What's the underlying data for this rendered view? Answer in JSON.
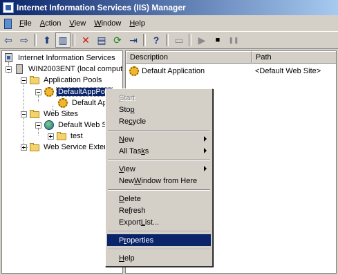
{
  "title": "Internet Information Services (IIS) Manager",
  "menu": [
    {
      "pre": "",
      "u": "F",
      "post": "ile"
    },
    {
      "pre": "",
      "u": "A",
      "post": "ction"
    },
    {
      "pre": "",
      "u": "V",
      "post": "iew"
    },
    {
      "pre": "",
      "u": "W",
      "post": "indow"
    },
    {
      "pre": "",
      "u": "H",
      "post": "elp"
    }
  ],
  "toolbar": {
    "icons": [
      "back-arrow-icon",
      "forward-arrow-icon",
      "up-folder-icon",
      "show-hide-tree-icon",
      "delete-icon",
      "properties-icon",
      "refresh-icon",
      "export-list-icon",
      "help-icon",
      "computer-icon",
      "play-icon",
      "stop-icon",
      "pause-icon"
    ],
    "glyphs": [
      "⇦",
      "⇨",
      "⬆",
      "▥",
      "✕",
      "▤",
      "⟳",
      "⇥",
      "?",
      "▭",
      "▶",
      "■",
      "❚❚"
    ]
  },
  "tree": {
    "root": "Internet Information Services",
    "server": "WIN2003ENT (local comput",
    "app_pools": "Application Pools",
    "default_pool": "DefaultAppPool",
    "default_app": "Default Ap",
    "web_sites": "Web Sites",
    "default_site": "Default Web S",
    "test": "test",
    "web_service_ext": "Web Service Exter"
  },
  "list": {
    "columns": [
      "Description",
      "Path"
    ],
    "rows": [
      {
        "description": "Default Application",
        "path": "<Default Web Site>"
      }
    ]
  },
  "context_menu": {
    "start": {
      "pre": "",
      "u": "S",
      "post": "tart"
    },
    "stop": {
      "pre": "Sto",
      "u": "p",
      "post": ""
    },
    "recycle": {
      "pre": "Re",
      "u": "c",
      "post": "ycle"
    },
    "new": {
      "pre": "",
      "u": "N",
      "post": "ew"
    },
    "all_tasks": {
      "pre": "All Tas",
      "u": "k",
      "post": "s"
    },
    "view": {
      "pre": "",
      "u": "V",
      "post": "iew"
    },
    "new_window": {
      "pre": "New ",
      "u": "W",
      "post": "indow from Here"
    },
    "delete": {
      "pre": "",
      "u": "D",
      "post": "elete"
    },
    "refresh": {
      "pre": "Re",
      "u": "f",
      "post": "resh"
    },
    "export_list": {
      "pre": "Export ",
      "u": "L",
      "post": "ist..."
    },
    "properties": {
      "pre": "P",
      "u": "r",
      "post": "operties"
    },
    "help": {
      "pre": "",
      "u": "H",
      "post": "elp"
    }
  },
  "colors": {
    "titlebar_start": "#0a246a",
    "titlebar_end": "#a6caf0",
    "selection": "#0a246a",
    "face": "#d4d0c8"
  }
}
